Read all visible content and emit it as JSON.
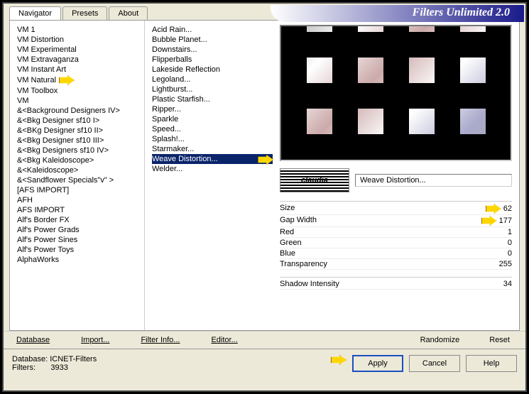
{
  "title": "Filters Unlimited 2.0",
  "tabs": {
    "navigator": "Navigator",
    "presets": "Presets",
    "about": "About"
  },
  "categories": [
    "VM 1",
    "VM Distortion",
    "VM Experimental",
    "VM Extravaganza",
    "VM Instant Art",
    "VM Natural",
    "VM Toolbox",
    "VM",
    "&<Background Designers IV>",
    "&<Bkg Designer sf10 I>",
    "&<BKg Designer sf10 II>",
    "&<Bkg Designer sf10 III>",
    "&<Bkg Designers sf10 IV>",
    "&<Bkg Kaleidoscope>",
    "&<Kaleidoscope>",
    "&<Sandflower Specials\"v\" >",
    "[AFS IMPORT]",
    "AFH",
    "AFS IMPORT",
    "Alf's Border FX",
    "Alf's Power Grads",
    "Alf's Power Sines",
    "Alf's Power Toys",
    "AlphaWorks"
  ],
  "highlight_category_index": 5,
  "filters": [
    "Acid Rain...",
    "Bubble Planet...",
    "Downstairs...",
    "Flipperballs",
    "Lakeside Reflection",
    "Legoland...",
    "Lightburst...",
    "Plastic Starfish...",
    "Ripper...",
    "Sparkle",
    "Speed...",
    "Splash!...",
    "Starmaker...",
    "Weave Distortion...",
    "Welder..."
  ],
  "selected_filter_index": 13,
  "logo_text": "claudia",
  "filter_name": "Weave Distortion...",
  "params": [
    {
      "label": "Size",
      "value": "62",
      "pointer": true
    },
    {
      "label": "Gap Width",
      "value": "177",
      "pointer": true
    },
    {
      "label": "Red",
      "value": "1"
    },
    {
      "label": "Green",
      "value": "0"
    },
    {
      "label": "Blue",
      "value": "0"
    },
    {
      "label": "Transparency",
      "value": "255"
    }
  ],
  "shadow_param": {
    "label": "Shadow Intensity",
    "value": "34"
  },
  "lower": {
    "database": "Database",
    "import": "Import...",
    "filterinfo": "Filter Info...",
    "editor": "Editor...",
    "randomize": "Randomize",
    "reset": "Reset"
  },
  "bottom": {
    "db_label": "Database:",
    "db_value": "ICNET-Filters",
    "filters_label": "Filters:",
    "filters_value": "3933"
  },
  "buttons": {
    "apply": "Apply",
    "cancel": "Cancel",
    "help": "Help"
  }
}
